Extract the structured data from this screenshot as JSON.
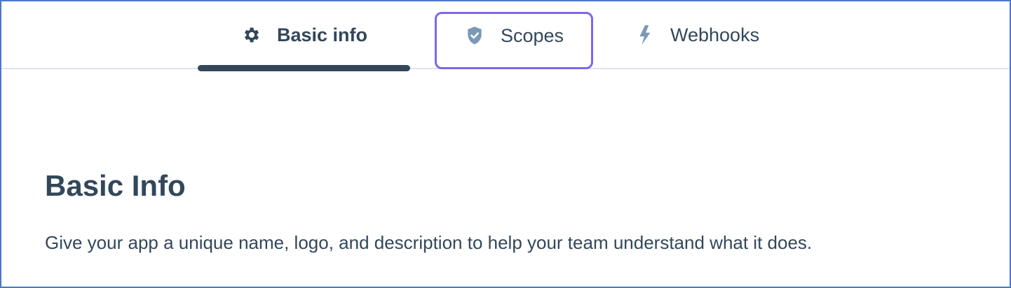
{
  "tabs": {
    "basic_info": {
      "label": "Basic info",
      "icon": "gear-icon",
      "active": true
    },
    "scopes": {
      "label": "Scopes",
      "icon": "shield-check-icon",
      "focused": true
    },
    "webhooks": {
      "label": "Webhooks",
      "icon": "lightning-bolt-icon"
    }
  },
  "section": {
    "title": "Basic Info",
    "description": "Give your app a unique name, logo, and description to help your team understand what it does."
  },
  "colors": {
    "text": "#33475b",
    "active_indicator": "#33475b",
    "focus_ring": "#7b68ee",
    "icon_muted": "#7c98b6",
    "divider": "#dfe3f0",
    "frame_border": "#4a78c9"
  }
}
